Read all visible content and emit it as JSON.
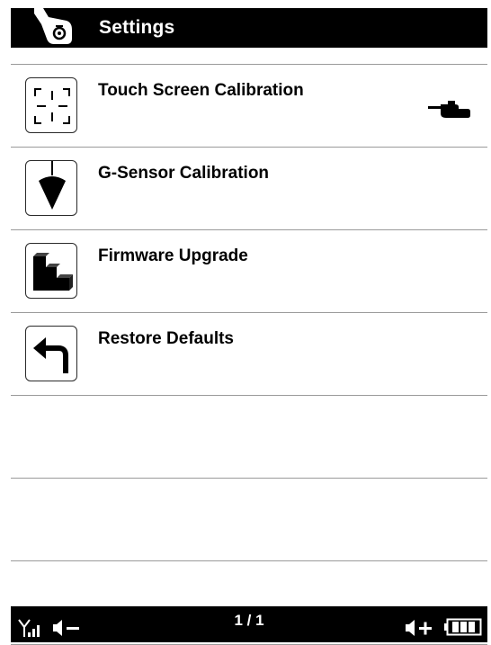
{
  "header": {
    "title": "Settings",
    "icon": "wrench-settings-icon"
  },
  "items": [
    {
      "label": "Touch Screen Calibration",
      "icon": "crosshair-calibration-icon",
      "selected": true
    },
    {
      "label": "G-Sensor Calibration",
      "icon": "plumb-bob-icon"
    },
    {
      "label": "Firmware Upgrade",
      "icon": "stairs-upgrade-icon"
    },
    {
      "label": "Restore Defaults",
      "icon": "return-arrow-icon"
    }
  ],
  "statusbar": {
    "page": "1 / 1",
    "signal_icon": "signal-antenna-icon",
    "volume_down_icon": "volume-down-icon",
    "volume_up_icon": "volume-up-icon",
    "battery_icon": "battery-icon"
  }
}
